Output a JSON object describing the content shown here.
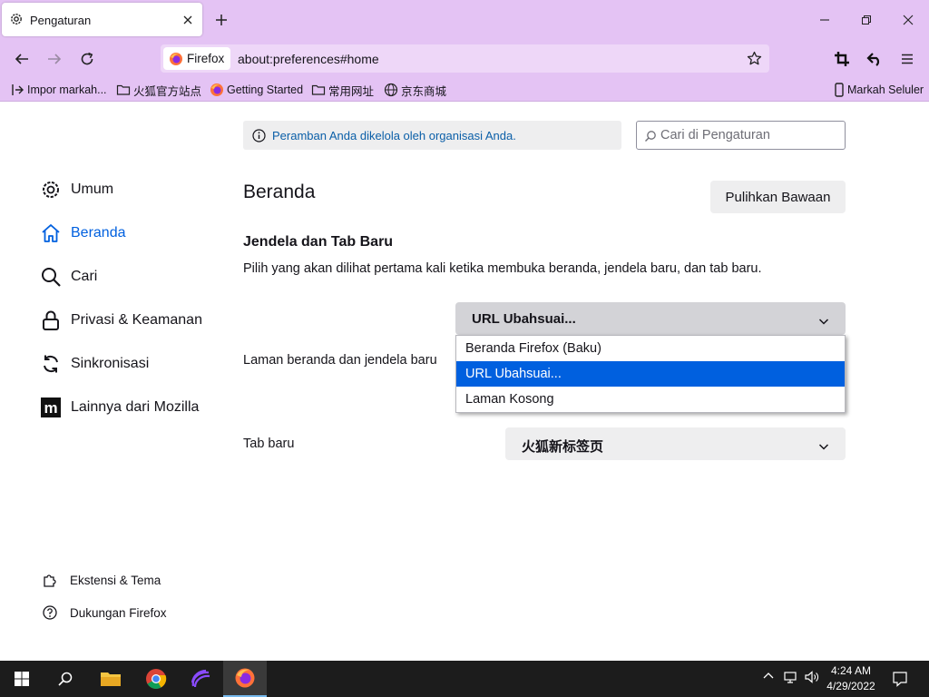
{
  "window": {
    "tab_title": "Pengaturan"
  },
  "navbar": {
    "identity_label": "Firefox",
    "url": "about:preferences#home"
  },
  "bookmarks": {
    "items": [
      {
        "label": "Impor markah..."
      },
      {
        "label": "火狐官方站点"
      },
      {
        "label": "Getting Started"
      },
      {
        "label": "常用网址"
      },
      {
        "label": "京东商城"
      }
    ],
    "mobile_label": "Markah Seluler"
  },
  "policy_notice": "Peramban Anda dikelola oleh organisasi Anda.",
  "search": {
    "placeholder": "Cari di Pengaturan"
  },
  "sidebar": {
    "items": [
      {
        "label": "Umum",
        "icon": "gear-icon"
      },
      {
        "label": "Beranda",
        "icon": "home-icon"
      },
      {
        "label": "Cari",
        "icon": "search-icon"
      },
      {
        "label": "Privasi & Keamanan",
        "icon": "lock-icon"
      },
      {
        "label": "Sinkronisasi",
        "icon": "sync-icon"
      },
      {
        "label": "Lainnya dari Mozilla",
        "icon": "mozilla-icon"
      }
    ],
    "footer": [
      {
        "label": "Ekstensi & Tema",
        "icon": "puzzle-icon"
      },
      {
        "label": "Dukungan Firefox",
        "icon": "help-icon"
      }
    ]
  },
  "main": {
    "title": "Beranda",
    "restore_button": "Pulihkan Bawaan",
    "section_title": "Jendela dan Tab Baru",
    "section_desc": "Pilih yang akan dilihat pertama kali ketika membuka beranda, jendela baru, dan tab baru.",
    "homepage": {
      "label": "Laman beranda dan jendela baru",
      "value": "URL Ubahsuai...",
      "options": [
        "Beranda Firefox (Baku)",
        "URL Ubahsuai...",
        "Laman Kosong"
      ],
      "selected_index": 1
    },
    "newtab": {
      "label": "Tab baru",
      "value": "火狐新标签页"
    }
  },
  "taskbar": {
    "time": "4:24 AM",
    "date": "4/29/2022"
  },
  "colors": {
    "chrome": "#e4c3f4",
    "accent": "#0060df",
    "taskbar": "#1c1c1c"
  }
}
